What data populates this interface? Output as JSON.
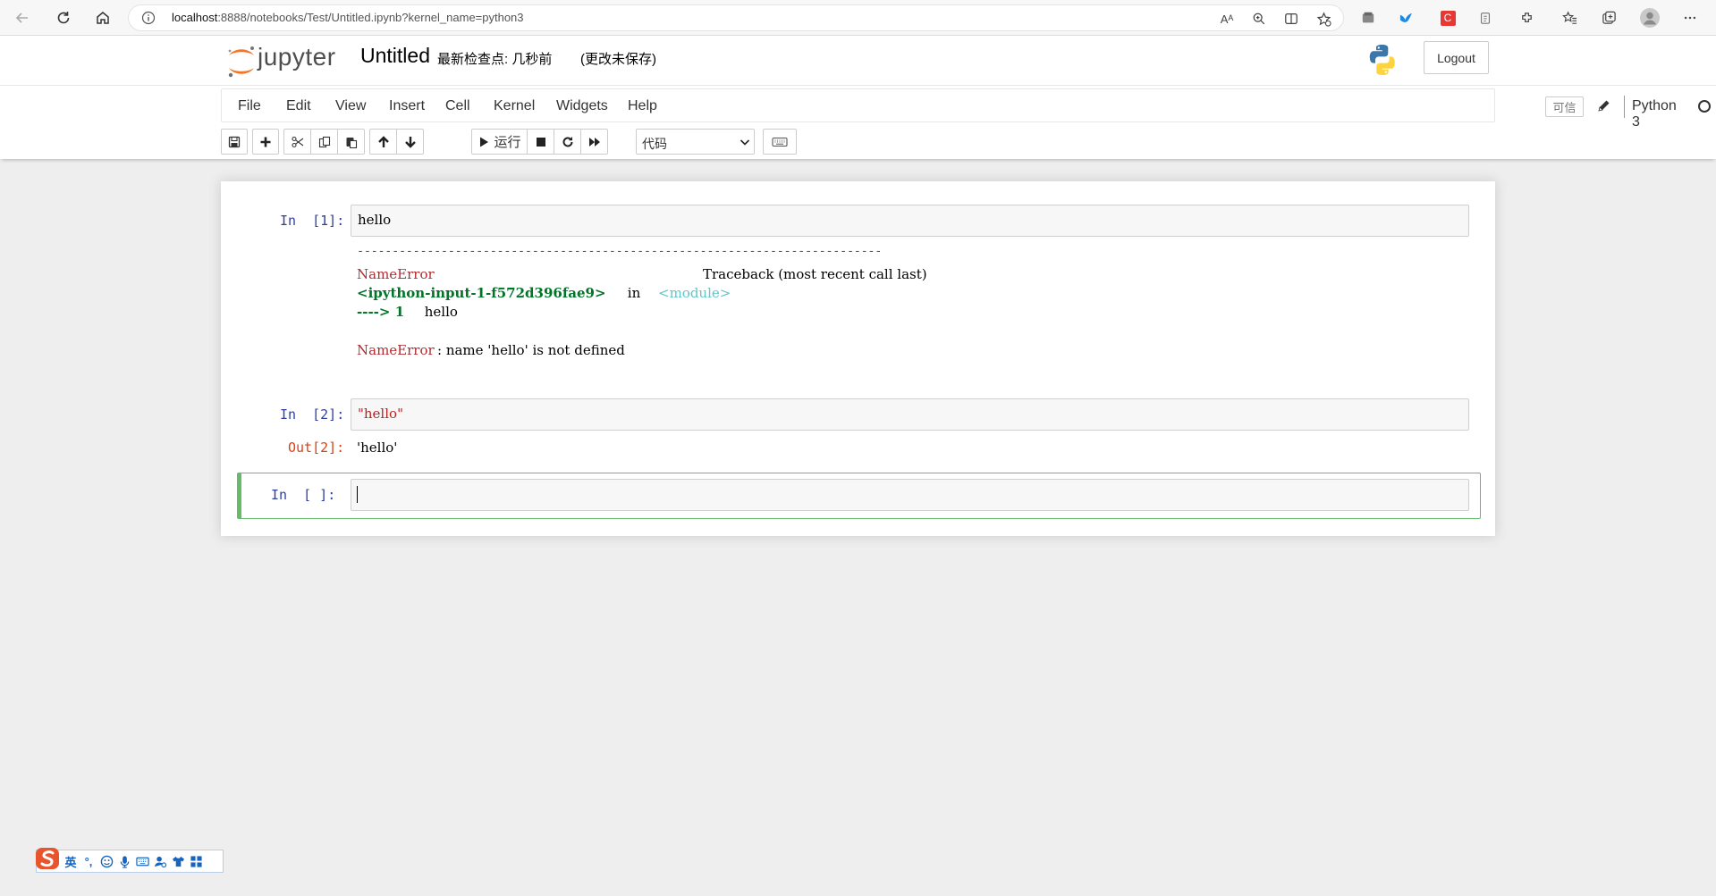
{
  "browser": {
    "url_host": "localhost",
    "url_rest": ":8888/notebooks/Test/Untitled.ipynb?kernel_name=python3",
    "read_aloud_label": "Aᴬ"
  },
  "header": {
    "logo_text": "jupyter",
    "notebook_title": "Untitled",
    "checkpoint_text": "最新检查点: 几秒前",
    "unsaved_text": "(更改未保存)",
    "logout_label": "Logout"
  },
  "menubar": {
    "items": [
      "File",
      "Edit",
      "View",
      "Insert",
      "Cell",
      "Kernel",
      "Widgets",
      "Help"
    ],
    "trusted_label": "可信",
    "kernel_name": "Python 3"
  },
  "toolbar": {
    "run_label": "运行",
    "cell_type_value": "代码"
  },
  "cells": [
    {
      "prompt": "In  [1]:",
      "source": "hello",
      "error": {
        "dash_line": "---------------------------------------------------------------------------",
        "ename": "NameError",
        "traceback_header": "Traceback (most recent call last)",
        "input_ref": "<ipython-input-1-f572d396fae9>",
        "in_word": " in ",
        "module_ref": "<module>",
        "arrow": "----> 1",
        "line": " hello",
        "final_ename": "NameError",
        "final_msg": ": name 'hello' is not defined"
      }
    },
    {
      "prompt": "In  [2]:",
      "source": "\"hello\"",
      "out_prompt": "Out[2]:",
      "output": "'hello'"
    },
    {
      "prompt": "In  [ ]:",
      "source": ""
    }
  ],
  "ime": {
    "lang_label": "英",
    "punct_label": "°,"
  },
  "colors": {
    "selected_cell_border": "#66bb6a",
    "prompt_in": "#303f9f",
    "prompt_out": "#d84315",
    "error_red": "#b22b31",
    "error_green": "#007427"
  }
}
